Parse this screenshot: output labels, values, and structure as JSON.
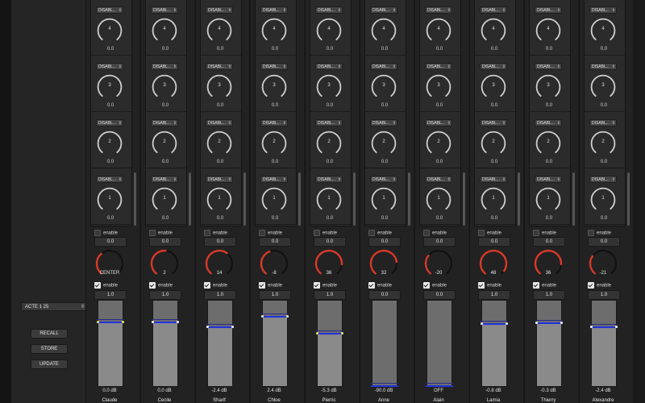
{
  "sidebar": {
    "preset": "ACTE 1 25",
    "buttons": [
      "RECALL",
      "STORE",
      "UPDATE"
    ]
  },
  "channels": [
    {
      "name": "Claude",
      "pan": "CENTER",
      "gain": "1.0",
      "db": "0.0 dB",
      "fader": 0.75
    },
    {
      "name": "Cecile",
      "pan": "2",
      "gain": "1.0",
      "db": "0.0 dB",
      "fader": 0.75
    },
    {
      "name": "Sharif",
      "pan": "14",
      "gain": "1.0",
      "db": "-2.4 dB",
      "fader": 0.69
    },
    {
      "name": "Chloe",
      "pan": "-8",
      "gain": "1.0",
      "db": "2.4 dB",
      "fader": 0.81
    },
    {
      "name": "Pierric",
      "pan": "36",
      "gain": "1.0",
      "db": "-5.3 dB",
      "fader": 0.61
    },
    {
      "name": "Anne",
      "pan": "32",
      "gain": "0.0",
      "db": "-90.0 dB",
      "fader": 0.0
    },
    {
      "name": "Alain",
      "pan": "-20",
      "gain": "0.0",
      "db": "OFF",
      "fader": 0.0
    },
    {
      "name": "Lamia",
      "pan": "48",
      "gain": "1.0",
      "db": "-0.8 dB",
      "fader": 0.73
    },
    {
      "name": "Thierry",
      "pan": "36",
      "gain": "1.0",
      "db": "-0.3 dB",
      "fader": 0.74
    },
    {
      "name": "Alexandre",
      "pan": "-21",
      "gain": "1.0",
      "db": "-2.4 dB",
      "fader": 0.69
    }
  ],
  "sends": {
    "mode": "DISABL...",
    "knobs": [
      "4",
      "3",
      "2",
      "1"
    ],
    "value": "0.0"
  },
  "labels": {
    "enable": "enable",
    "pan_value": "0.0"
  },
  "colors": {
    "pan_arc": "#d83a2a",
    "fader_line": "#2233dd",
    "dot": "#f1e84a"
  }
}
